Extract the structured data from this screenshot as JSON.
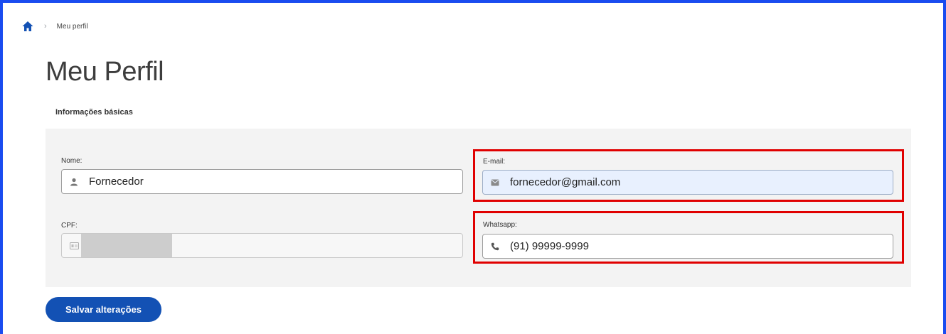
{
  "breadcrumb": {
    "current": "Meu perfil"
  },
  "page": {
    "title": "Meu Perfil"
  },
  "section": {
    "title": "Informações básicas"
  },
  "form": {
    "nome": {
      "label": "Nome:",
      "value": "Fornecedor",
      "icon": "user-icon"
    },
    "email": {
      "label": "E-mail:",
      "value": "fornecedor@gmail.com",
      "icon": "envelope-icon"
    },
    "cpf": {
      "label": "CPF:",
      "value": "",
      "icon": "id-card-icon"
    },
    "whatsapp": {
      "label": "Whatsapp:",
      "value": "(91) 99999-9999",
      "icon": "phone-icon"
    }
  },
  "actions": {
    "save_label": "Salvar alterações"
  },
  "colors": {
    "frame": "#1a4cf0",
    "highlight": "#e00000",
    "primary": "#1351b4",
    "panel": "#f3f3f3"
  }
}
